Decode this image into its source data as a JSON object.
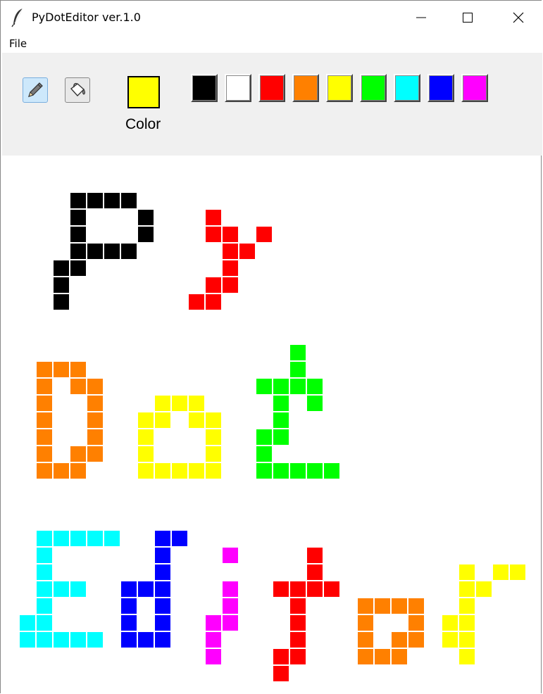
{
  "window": {
    "title": "PyDotEditor ver.1.0"
  },
  "menu": {
    "file": "File"
  },
  "toolbar": {
    "color_label": "Color",
    "current_color": "#ffff00",
    "palette": [
      "#000000",
      "#ffffff",
      "#ff0000",
      "#ff8000",
      "#ffff00",
      "#00ff00",
      "#00ffff",
      "#0000ff",
      "#ff00ff"
    ]
  },
  "canvas": {
    "grid_cells": 32,
    "pixels": [
      {
        "color": "#000000",
        "cells": [
          [
            4,
            2
          ],
          [
            5,
            2
          ],
          [
            6,
            2
          ],
          [
            7,
            2
          ],
          [
            4,
            3
          ],
          [
            8,
            3
          ],
          [
            4,
            4
          ],
          [
            8,
            4
          ],
          [
            4,
            5
          ],
          [
            5,
            5
          ],
          [
            6,
            5
          ],
          [
            7,
            5
          ],
          [
            3,
            6
          ],
          [
            4,
            6
          ],
          [
            3,
            7
          ],
          [
            3,
            8
          ]
        ]
      },
      {
        "color": "#ff0000",
        "cells": [
          [
            12,
            3
          ],
          [
            12,
            4
          ],
          [
            13,
            4
          ],
          [
            15,
            4
          ],
          [
            13,
            5
          ],
          [
            14,
            5
          ],
          [
            13,
            6
          ],
          [
            12,
            7
          ],
          [
            13,
            7
          ],
          [
            11,
            8
          ],
          [
            12,
            8
          ]
        ]
      },
      {
        "color": "#ff8000",
        "cells": [
          [
            2,
            12
          ],
          [
            3,
            12
          ],
          [
            4,
            12
          ],
          [
            2,
            13
          ],
          [
            4,
            13
          ],
          [
            5,
            13
          ],
          [
            2,
            14
          ],
          [
            5,
            14
          ],
          [
            2,
            15
          ],
          [
            5,
            15
          ],
          [
            2,
            16
          ],
          [
            5,
            16
          ],
          [
            2,
            17
          ],
          [
            4,
            17
          ],
          [
            5,
            17
          ],
          [
            2,
            18
          ],
          [
            3,
            18
          ],
          [
            4,
            18
          ]
        ]
      },
      {
        "color": "#ffff00",
        "cells": [
          [
            9,
            14
          ],
          [
            10,
            14
          ],
          [
            11,
            14
          ],
          [
            8,
            15
          ],
          [
            9,
            15
          ],
          [
            11,
            15
          ],
          [
            12,
            15
          ],
          [
            8,
            16
          ],
          [
            12,
            16
          ],
          [
            8,
            17
          ],
          [
            12,
            17
          ],
          [
            8,
            18
          ],
          [
            9,
            18
          ],
          [
            10,
            18
          ],
          [
            11,
            18
          ],
          [
            12,
            18
          ]
        ]
      },
      {
        "color": "#00ff00",
        "cells": [
          [
            17,
            11
          ],
          [
            17,
            12
          ],
          [
            15,
            13
          ],
          [
            16,
            13
          ],
          [
            17,
            13
          ],
          [
            18,
            13
          ],
          [
            16,
            14
          ],
          [
            18,
            14
          ],
          [
            16,
            15
          ],
          [
            15,
            16
          ],
          [
            16,
            16
          ],
          [
            15,
            17
          ],
          [
            15,
            18
          ],
          [
            16,
            18
          ],
          [
            17,
            18
          ],
          [
            18,
            18
          ],
          [
            19,
            18
          ]
        ]
      },
      {
        "color": "#00ffff",
        "cells": [
          [
            2,
            22
          ],
          [
            3,
            22
          ],
          [
            4,
            22
          ],
          [
            5,
            22
          ],
          [
            6,
            22
          ],
          [
            2,
            23
          ],
          [
            2,
            24
          ],
          [
            2,
            25
          ],
          [
            3,
            25
          ],
          [
            4,
            25
          ],
          [
            2,
            26
          ],
          [
            1,
            27
          ],
          [
            2,
            27
          ],
          [
            1,
            28
          ],
          [
            2,
            28
          ],
          [
            3,
            28
          ],
          [
            4,
            28
          ],
          [
            5,
            28
          ]
        ]
      },
      {
        "color": "#0000ff",
        "cells": [
          [
            9,
            22
          ],
          [
            10,
            22
          ],
          [
            9,
            23
          ],
          [
            9,
            24
          ],
          [
            7,
            25
          ],
          [
            8,
            25
          ],
          [
            9,
            25
          ],
          [
            7,
            26
          ],
          [
            9,
            26
          ],
          [
            7,
            27
          ],
          [
            9,
            27
          ],
          [
            7,
            28
          ],
          [
            8,
            28
          ],
          [
            9,
            28
          ]
        ]
      },
      {
        "color": "#ff00ff",
        "cells": [
          [
            13,
            23
          ],
          [
            13,
            25
          ],
          [
            13,
            26
          ],
          [
            12,
            27
          ],
          [
            13,
            27
          ],
          [
            12,
            28
          ],
          [
            12,
            29
          ]
        ]
      },
      {
        "color": "#ff0000",
        "cells": [
          [
            18,
            23
          ],
          [
            18,
            24
          ],
          [
            16,
            25
          ],
          [
            17,
            25
          ],
          [
            18,
            25
          ],
          [
            19,
            25
          ],
          [
            17,
            26
          ],
          [
            17,
            27
          ],
          [
            17,
            28
          ],
          [
            16,
            29
          ],
          [
            17,
            29
          ],
          [
            16,
            30
          ]
        ]
      },
      {
        "color": "#ff8000",
        "cells": [
          [
            21,
            26
          ],
          [
            22,
            26
          ],
          [
            23,
            26
          ],
          [
            24,
            26
          ],
          [
            21,
            27
          ],
          [
            24,
            27
          ],
          [
            21,
            28
          ],
          [
            23,
            28
          ],
          [
            24,
            28
          ],
          [
            21,
            29
          ],
          [
            22,
            29
          ],
          [
            23,
            29
          ]
        ]
      },
      {
        "color": "#ffff00",
        "cells": [
          [
            27,
            24
          ],
          [
            29,
            24
          ],
          [
            30,
            24
          ],
          [
            27,
            25
          ],
          [
            28,
            25
          ],
          [
            27,
            26
          ],
          [
            26,
            27
          ],
          [
            27,
            27
          ],
          [
            26,
            28
          ],
          [
            27,
            28
          ],
          [
            27,
            29
          ]
        ]
      }
    ]
  }
}
